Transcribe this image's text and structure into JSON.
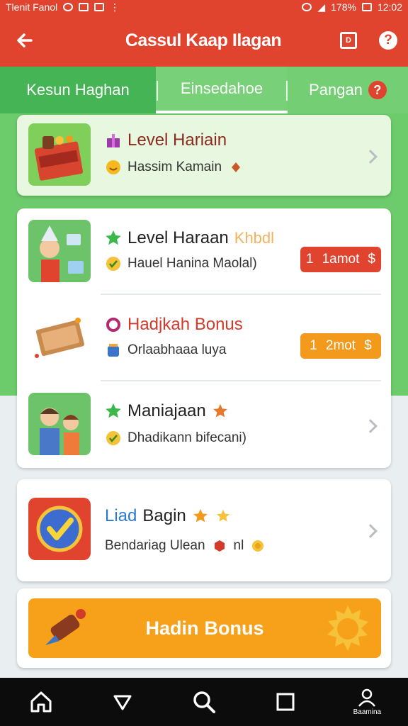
{
  "status_bar": {
    "left_text": "Tlenit Fanol",
    "battery": "178%",
    "time": "12:02"
  },
  "app_bar": {
    "title": "Cassul Kaap Ilagan",
    "box_icon_label": "D",
    "help_label": "?"
  },
  "tabs": [
    {
      "label": "Kesun Haghan"
    },
    {
      "label": "Einsedahoe"
    },
    {
      "label": "Pangan",
      "badge": "?"
    }
  ],
  "card_top": {
    "title": "Level Hariain",
    "subtitle": "Hassim Kamain"
  },
  "group1": {
    "rows": [
      {
        "title": "Level Haraan",
        "extra": "Khbdl",
        "subtitle": "Hauel Hanina Maolal)",
        "pill_left": "1",
        "pill_text": "1amot",
        "pill_currency": "$"
      },
      {
        "title": "Hadjkah Bonus",
        "subtitle": "Orlaabhaaa luya",
        "pill_left": "1",
        "pill_text": "2mot",
        "pill_currency": "$"
      },
      {
        "title": "Maniajaan",
        "subtitle": "Dhadikann bifecani)"
      }
    ]
  },
  "card_lead": {
    "title_a": "Liad",
    "title_b": "Bagin",
    "subtitle_a": "Bendariag Ulean",
    "subtitle_b": "nl"
  },
  "bonus_button": {
    "label_a": "Hadin",
    "label_b": "Bonus"
  },
  "nav": [
    {
      "icon": "home-icon"
    },
    {
      "icon": "back-triangle-icon"
    },
    {
      "icon": "search-icon"
    },
    {
      "icon": "square-icon"
    },
    {
      "icon": "profile-icon",
      "label": "Baamina"
    }
  ],
  "colors": {
    "primary_red": "#e0442e",
    "green": "#6ccb6a",
    "orange": "#f7a01a",
    "pill_red": "#e0442e",
    "pill_orange": "#f39a1c"
  }
}
